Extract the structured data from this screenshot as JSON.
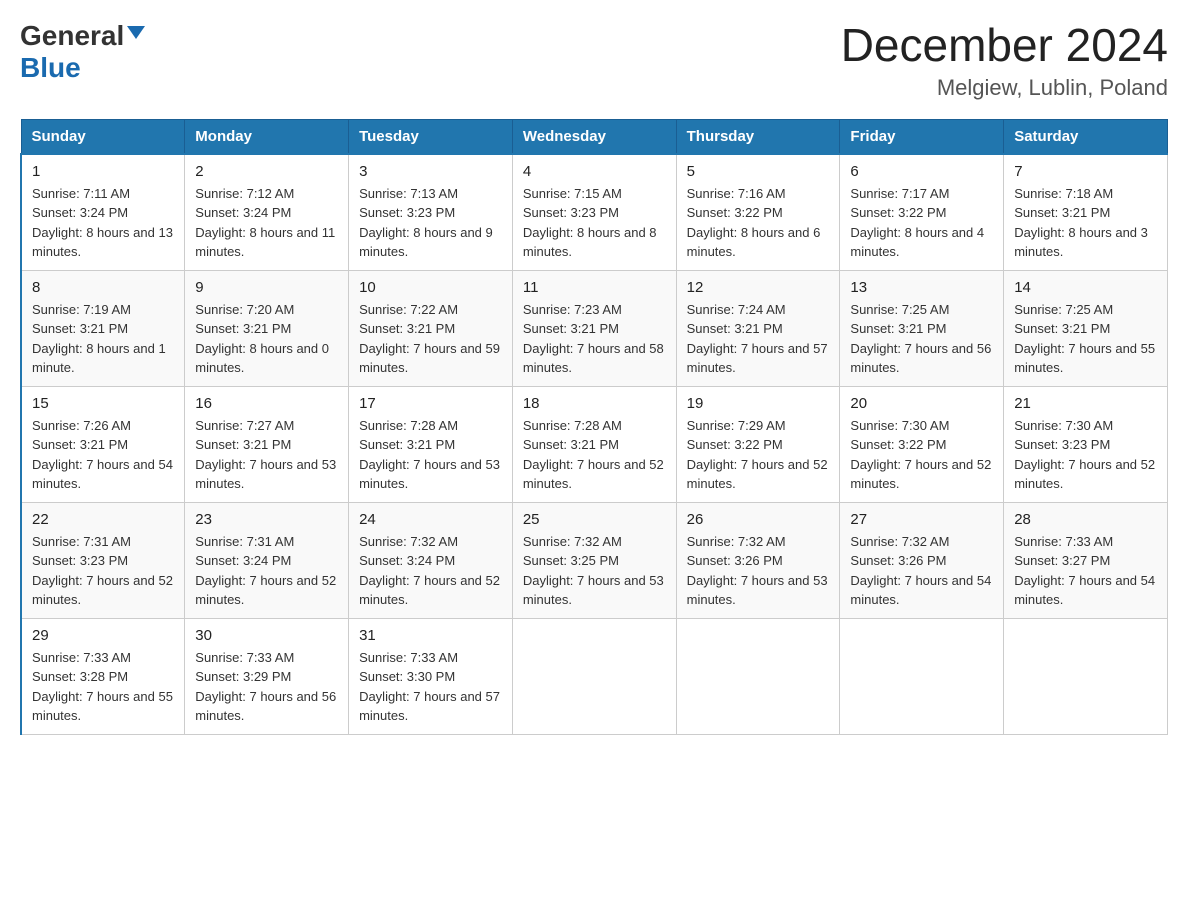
{
  "header": {
    "title": "December 2024",
    "subtitle": "Melgiew, Lublin, Poland",
    "logo_general": "General",
    "logo_blue": "Blue"
  },
  "columns": [
    "Sunday",
    "Monday",
    "Tuesday",
    "Wednesday",
    "Thursday",
    "Friday",
    "Saturday"
  ],
  "weeks": [
    [
      {
        "day": "1",
        "sunrise": "7:11 AM",
        "sunset": "3:24 PM",
        "daylight": "8 hours and 13 minutes."
      },
      {
        "day": "2",
        "sunrise": "7:12 AM",
        "sunset": "3:24 PM",
        "daylight": "8 hours and 11 minutes."
      },
      {
        "day": "3",
        "sunrise": "7:13 AM",
        "sunset": "3:23 PM",
        "daylight": "8 hours and 9 minutes."
      },
      {
        "day": "4",
        "sunrise": "7:15 AM",
        "sunset": "3:23 PM",
        "daylight": "8 hours and 8 minutes."
      },
      {
        "day": "5",
        "sunrise": "7:16 AM",
        "sunset": "3:22 PM",
        "daylight": "8 hours and 6 minutes."
      },
      {
        "day": "6",
        "sunrise": "7:17 AM",
        "sunset": "3:22 PM",
        "daylight": "8 hours and 4 minutes."
      },
      {
        "day": "7",
        "sunrise": "7:18 AM",
        "sunset": "3:21 PM",
        "daylight": "8 hours and 3 minutes."
      }
    ],
    [
      {
        "day": "8",
        "sunrise": "7:19 AM",
        "sunset": "3:21 PM",
        "daylight": "8 hours and 1 minute."
      },
      {
        "day": "9",
        "sunrise": "7:20 AM",
        "sunset": "3:21 PM",
        "daylight": "8 hours and 0 minutes."
      },
      {
        "day": "10",
        "sunrise": "7:22 AM",
        "sunset": "3:21 PM",
        "daylight": "7 hours and 59 minutes."
      },
      {
        "day": "11",
        "sunrise": "7:23 AM",
        "sunset": "3:21 PM",
        "daylight": "7 hours and 58 minutes."
      },
      {
        "day": "12",
        "sunrise": "7:24 AM",
        "sunset": "3:21 PM",
        "daylight": "7 hours and 57 minutes."
      },
      {
        "day": "13",
        "sunrise": "7:25 AM",
        "sunset": "3:21 PM",
        "daylight": "7 hours and 56 minutes."
      },
      {
        "day": "14",
        "sunrise": "7:25 AM",
        "sunset": "3:21 PM",
        "daylight": "7 hours and 55 minutes."
      }
    ],
    [
      {
        "day": "15",
        "sunrise": "7:26 AM",
        "sunset": "3:21 PM",
        "daylight": "7 hours and 54 minutes."
      },
      {
        "day": "16",
        "sunrise": "7:27 AM",
        "sunset": "3:21 PM",
        "daylight": "7 hours and 53 minutes."
      },
      {
        "day": "17",
        "sunrise": "7:28 AM",
        "sunset": "3:21 PM",
        "daylight": "7 hours and 53 minutes."
      },
      {
        "day": "18",
        "sunrise": "7:28 AM",
        "sunset": "3:21 PM",
        "daylight": "7 hours and 52 minutes."
      },
      {
        "day": "19",
        "sunrise": "7:29 AM",
        "sunset": "3:22 PM",
        "daylight": "7 hours and 52 minutes."
      },
      {
        "day": "20",
        "sunrise": "7:30 AM",
        "sunset": "3:22 PM",
        "daylight": "7 hours and 52 minutes."
      },
      {
        "day": "21",
        "sunrise": "7:30 AM",
        "sunset": "3:23 PM",
        "daylight": "7 hours and 52 minutes."
      }
    ],
    [
      {
        "day": "22",
        "sunrise": "7:31 AM",
        "sunset": "3:23 PM",
        "daylight": "7 hours and 52 minutes."
      },
      {
        "day": "23",
        "sunrise": "7:31 AM",
        "sunset": "3:24 PM",
        "daylight": "7 hours and 52 minutes."
      },
      {
        "day": "24",
        "sunrise": "7:32 AM",
        "sunset": "3:24 PM",
        "daylight": "7 hours and 52 minutes."
      },
      {
        "day": "25",
        "sunrise": "7:32 AM",
        "sunset": "3:25 PM",
        "daylight": "7 hours and 53 minutes."
      },
      {
        "day": "26",
        "sunrise": "7:32 AM",
        "sunset": "3:26 PM",
        "daylight": "7 hours and 53 minutes."
      },
      {
        "day": "27",
        "sunrise": "7:32 AM",
        "sunset": "3:26 PM",
        "daylight": "7 hours and 54 minutes."
      },
      {
        "day": "28",
        "sunrise": "7:33 AM",
        "sunset": "3:27 PM",
        "daylight": "7 hours and 54 minutes."
      }
    ],
    [
      {
        "day": "29",
        "sunrise": "7:33 AM",
        "sunset": "3:28 PM",
        "daylight": "7 hours and 55 minutes."
      },
      {
        "day": "30",
        "sunrise": "7:33 AM",
        "sunset": "3:29 PM",
        "daylight": "7 hours and 56 minutes."
      },
      {
        "day": "31",
        "sunrise": "7:33 AM",
        "sunset": "3:30 PM",
        "daylight": "7 hours and 57 minutes."
      },
      null,
      null,
      null,
      null
    ]
  ],
  "labels": {
    "sunrise": "Sunrise:",
    "sunset": "Sunset:",
    "daylight": "Daylight:"
  }
}
